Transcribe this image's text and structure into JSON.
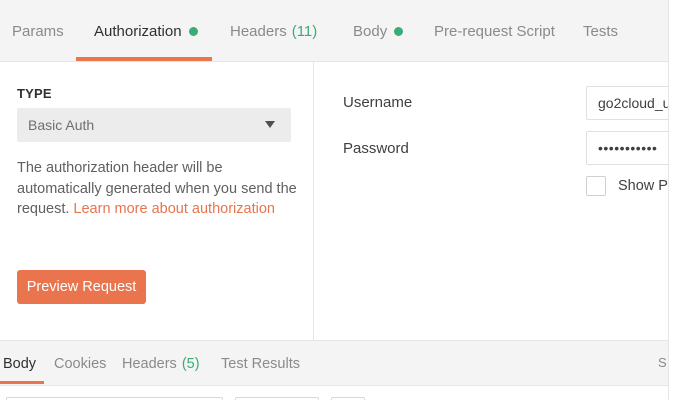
{
  "request_tabs": [
    {
      "label": "Params"
    },
    {
      "label": "Authorization",
      "has_dot": true
    },
    {
      "label": "Headers",
      "count": "(11)"
    },
    {
      "label": "Body",
      "has_dot": true
    },
    {
      "label": "Pre-request Script"
    },
    {
      "label": "Tests"
    }
  ],
  "auth": {
    "type_label": "TYPE",
    "type_value": "Basic Auth",
    "description_text": "The authorization header will be automatically generated when you send the request. ",
    "learn_more_link": "Learn more about authorization",
    "preview_button": "Preview Request"
  },
  "credentials": {
    "username_label": "Username",
    "username_value": "go2cloud_u",
    "password_label": "Password",
    "password_value": "•••••••••••",
    "show_password_label": "Show Pa"
  },
  "response_tabs": [
    {
      "label": "Body"
    },
    {
      "label": "Cookies"
    },
    {
      "label": "Headers",
      "count": "(5)"
    },
    {
      "label": "Test Results"
    }
  ],
  "response_right_text": "S",
  "colors": {
    "accent": "#e9744d",
    "status_green": "#3cab77"
  }
}
